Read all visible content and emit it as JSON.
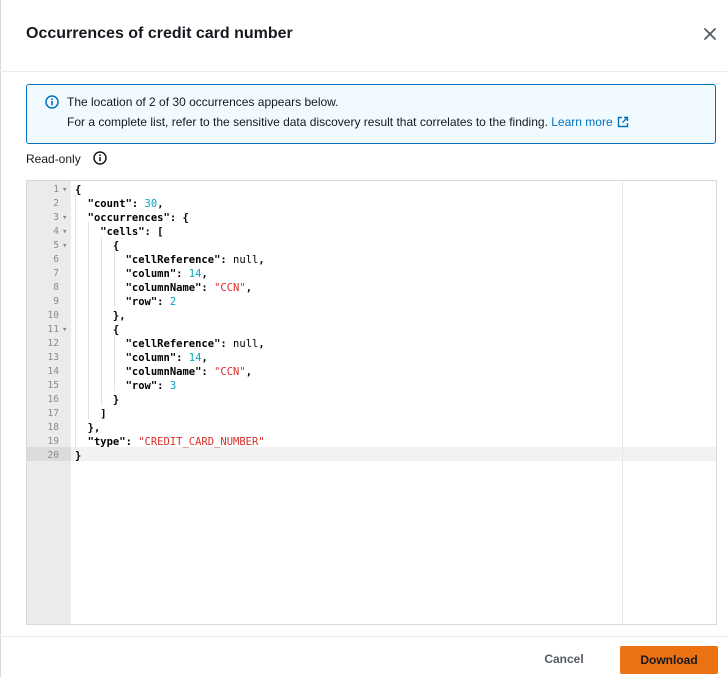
{
  "modal": {
    "title": "Occurrences of credit card number"
  },
  "alert": {
    "line1": "The location of 2 of 30 occurrences appears below.",
    "line2": "For a complete list, refer to the sensitive data discovery result that correlates to the finding.",
    "link_label": "Learn more",
    "accent_color": "#0073bb"
  },
  "editor": {
    "readonly_label": "Read-only",
    "line_numbers": [
      "1",
      "2",
      "3",
      "4",
      "5",
      "6",
      "7",
      "8",
      "9",
      "10",
      "11",
      "12",
      "13",
      "14",
      "15",
      "16",
      "17",
      "18",
      "19",
      "20"
    ],
    "active_line": "20",
    "lines": [
      {
        "ln": "1",
        "fold": true,
        "tokens": [
          [
            "p",
            "{"
          ]
        ]
      },
      {
        "ln": "2",
        "tokens": [
          [
            "p",
            "  \"count\": "
          ],
          [
            "num",
            "30"
          ],
          [
            "p",
            ","
          ]
        ]
      },
      {
        "ln": "3",
        "fold": true,
        "tokens": [
          [
            "p",
            "  \"occurrences\": {"
          ]
        ]
      },
      {
        "ln": "4",
        "fold": true,
        "tokens": [
          [
            "p",
            "    \"cells\": ["
          ]
        ]
      },
      {
        "ln": "5",
        "fold": true,
        "tokens": [
          [
            "p",
            "      {"
          ]
        ]
      },
      {
        "ln": "6",
        "tokens": [
          [
            "p",
            "        \"cellReference\": "
          ],
          [
            "nul",
            "null"
          ],
          [
            "p",
            ","
          ]
        ]
      },
      {
        "ln": "7",
        "tokens": [
          [
            "p",
            "        \"column\": "
          ],
          [
            "num",
            "14"
          ],
          [
            "p",
            ","
          ]
        ]
      },
      {
        "ln": "8",
        "tokens": [
          [
            "p",
            "        \"columnName\": "
          ],
          [
            "str",
            "\"CCN\""
          ],
          [
            "p",
            ","
          ]
        ]
      },
      {
        "ln": "9",
        "tokens": [
          [
            "p",
            "        \"row\": "
          ],
          [
            "num",
            "2"
          ]
        ]
      },
      {
        "ln": "10",
        "tokens": [
          [
            "p",
            "      },"
          ]
        ]
      },
      {
        "ln": "11",
        "fold": true,
        "tokens": [
          [
            "p",
            "      {"
          ]
        ]
      },
      {
        "ln": "12",
        "tokens": [
          [
            "p",
            "        \"cellReference\": "
          ],
          [
            "nul",
            "null"
          ],
          [
            "p",
            ","
          ]
        ]
      },
      {
        "ln": "13",
        "tokens": [
          [
            "p",
            "        \"column\": "
          ],
          [
            "num",
            "14"
          ],
          [
            "p",
            ","
          ]
        ]
      },
      {
        "ln": "14",
        "tokens": [
          [
            "p",
            "        \"columnName\": "
          ],
          [
            "str",
            "\"CCN\""
          ],
          [
            "p",
            ","
          ]
        ]
      },
      {
        "ln": "15",
        "tokens": [
          [
            "p",
            "        \"row\": "
          ],
          [
            "num",
            "3"
          ]
        ]
      },
      {
        "ln": "16",
        "tokens": [
          [
            "p",
            "      }"
          ]
        ]
      },
      {
        "ln": "17",
        "tokens": [
          [
            "p",
            "    ]"
          ]
        ]
      },
      {
        "ln": "18",
        "tokens": [
          [
            "p",
            "  },"
          ]
        ]
      },
      {
        "ln": "19",
        "tokens": [
          [
            "p",
            "  \"type\": "
          ],
          [
            "str",
            "\"CREDIT_CARD_NUMBER\""
          ]
        ]
      },
      {
        "ln": "20",
        "tokens": [
          [
            "p",
            "}"
          ]
        ]
      }
    ]
  },
  "footer": {
    "cancel_label": "Cancel",
    "download_label": "Download",
    "primary_color": "#ec7211"
  },
  "icons": {
    "close": "close-icon",
    "info": "info-icon",
    "external": "external-link-icon",
    "fold": "fold-arrow-icon"
  }
}
